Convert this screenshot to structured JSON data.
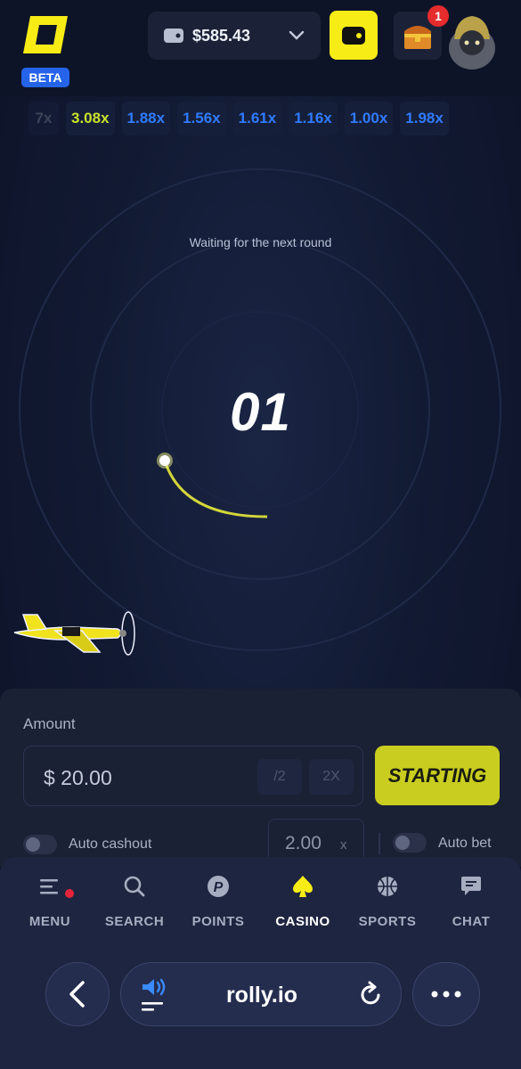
{
  "header": {
    "beta_label": "BETA",
    "balance": "$585.43",
    "notification_count": "1"
  },
  "multipliers": [
    "7x",
    "3.08x",
    "1.88x",
    "1.56x",
    "1.61x",
    "1.16x",
    "1.00x",
    "1.98x"
  ],
  "game": {
    "status": "Waiting for the next round",
    "countdown": "01"
  },
  "bet": {
    "amount_label": "Amount",
    "amount_value": "$ 20.00",
    "half_label": "/2",
    "double_label": "2X",
    "start_label": "STARTING",
    "auto_cashout_label": "Auto cashout",
    "auto_cashout_value": "2.00",
    "auto_cashout_unit": "x",
    "auto_bet_label": "Auto bet"
  },
  "nav": {
    "items": [
      {
        "label": "MENU",
        "icon": "menu-icon"
      },
      {
        "label": "SEARCH",
        "icon": "search-icon"
      },
      {
        "label": "POINTS",
        "icon": "points-icon"
      },
      {
        "label": "CASINO",
        "icon": "spade-icon"
      },
      {
        "label": "SPORTS",
        "icon": "basketball-icon"
      },
      {
        "label": "CHAT",
        "icon": "chat-icon"
      }
    ]
  },
  "browser": {
    "url": "rolly.io"
  },
  "colors": {
    "accent": "#f7ec15",
    "highlight_multiplier": "#c9e32a",
    "blue_multiplier": "#2f7bff",
    "badge": "#2563eb"
  }
}
